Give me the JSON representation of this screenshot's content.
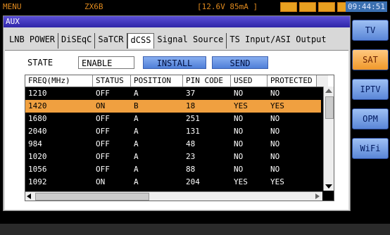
{
  "topbar": {
    "menu": "MENU",
    "model": "ZX6B",
    "status": "[12.6V 85mA ]",
    "time": "09:44:51"
  },
  "window": {
    "title": "AUX"
  },
  "tabs": [
    "LNB POWER",
    "DiSEqC",
    "SaTCR",
    "dCSS",
    "Signal Source",
    "TS Input/ASI Output"
  ],
  "active_tab": "dCSS",
  "controls": {
    "state_label": "STATE",
    "state_value": "ENABLE",
    "install_label": "INSTALL",
    "send_label": "SEND"
  },
  "table": {
    "columns": [
      "FREQ(MHz)",
      "STATUS",
      "POSITION",
      "PIN CODE",
      "USED",
      "PROTECTED"
    ],
    "rows": [
      [
        "1210",
        "OFF",
        "A",
        "37",
        "NO",
        "NO"
      ],
      [
        "1420",
        "ON",
        "B",
        "18",
        "YES",
        "YES"
      ],
      [
        "1680",
        "OFF",
        "A",
        "251",
        "NO",
        "NO"
      ],
      [
        "2040",
        "OFF",
        "A",
        "131",
        "NO",
        "NO"
      ],
      [
        "984",
        "OFF",
        "A",
        "48",
        "NO",
        "NO"
      ],
      [
        "1020",
        "OFF",
        "A",
        "23",
        "NO",
        "NO"
      ],
      [
        "1056",
        "OFF",
        "A",
        "88",
        "NO",
        "NO"
      ],
      [
        "1092",
        "ON",
        "A",
        "204",
        "YES",
        "YES"
      ]
    ],
    "selected_row": 1
  },
  "sidebar": [
    "TV",
    "SAT",
    "IPTV",
    "OPM",
    "WiFi"
  ],
  "active_side": "SAT"
}
